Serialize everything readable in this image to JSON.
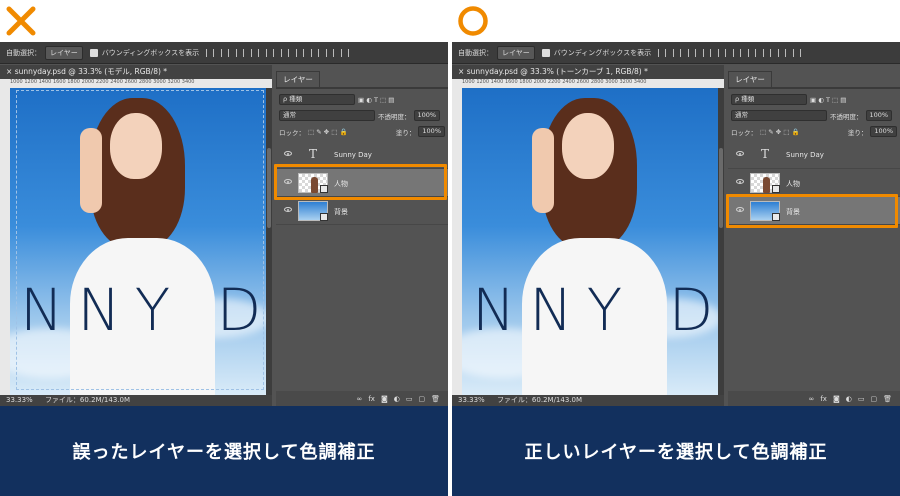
{
  "colors": {
    "wrong_mark": "#f08a00",
    "right_mark": "#f08a00",
    "highlight": "#f08a00",
    "caption_bg": "#12305e",
    "panel_bg": "#535353"
  },
  "ps_common": {
    "auto_select_label": "自動選択：",
    "auto_select_value": "レイヤー",
    "bounding_box_label": "バウンディングボックスを表示",
    "layers_tab": "レイヤー",
    "kind_filter": "ρ 種類",
    "blend_mode": "通常",
    "opacity_label": "不透明度：",
    "opacity_value": "100%",
    "lock_label": "ロック：",
    "fill_label": "塗り：",
    "fill_value": "100%",
    "zoom": "33.33%",
    "file_info": "ファイル：60.2M/143.0M",
    "ruler_labels": "1000  1200  1400  1600  1800  2000  2200  2400  2600  2800  3000  3200  3400",
    "canvas_text": "NNY D"
  },
  "left": {
    "mark_icon": "cross-icon",
    "doc_title": "sunnyday.psd @ 33.3% (モデル, RGB/8) *",
    "layers": [
      {
        "name": "Sunny Day",
        "kind": "text-icon"
      },
      {
        "name": "人物",
        "kind": "person"
      },
      {
        "name": "背景",
        "kind": "background"
      }
    ],
    "caption": "誤ったレイヤーを選択して色調補正"
  },
  "right": {
    "mark_icon": "circle-icon",
    "doc_title": "sunnyday.psd @ 33.3% (トーンカーブ 1, RGB/8) *",
    "layers": [
      {
        "name": "Sunny Day",
        "kind": "text-icon"
      },
      {
        "name": "人物",
        "kind": "person"
      },
      {
        "name": "背景",
        "kind": "background"
      }
    ],
    "caption": "正しいレイヤーを選択して色調補正"
  }
}
